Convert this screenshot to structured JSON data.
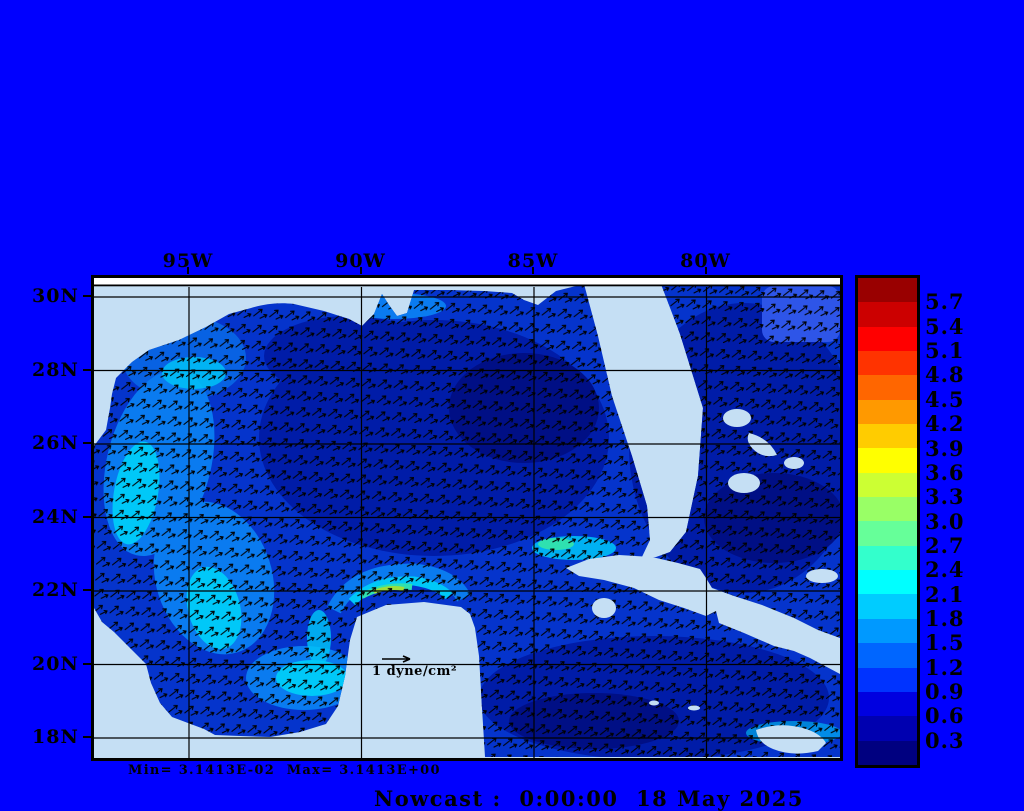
{
  "colors": {
    "background": "#0000FF",
    "land": "#C5DFF4",
    "water": "#0534CC",
    "frame": "#000000",
    "text": "#000000"
  },
  "axes": {
    "lon_ticks": [
      "95W",
      "90W",
      "85W",
      "80W"
    ],
    "lat_ticks": [
      "30N",
      "28N",
      "26N",
      "24N",
      "22N",
      "20N",
      "18N"
    ]
  },
  "colorbar": {
    "tick_labels": [
      "5.7",
      "5.4",
      "5.1",
      "4.8",
      "4.5",
      "4.2",
      "3.9",
      "3.6",
      "3.3",
      "3.0",
      "2.7",
      "2.4",
      "2.1",
      "1.8",
      "1.5",
      "1.2",
      "0.9",
      "0.6",
      "0.3"
    ],
    "segment_colors_top_to_bottom": [
      "#990000",
      "#CC0000",
      "#FF0000",
      "#FF3300",
      "#FF6600",
      "#FF9900",
      "#FFCC00",
      "#FFFF00",
      "#CCFF33",
      "#99FF66",
      "#66FF99",
      "#33FFCC",
      "#00FFFF",
      "#00CCFF",
      "#0099FF",
      "#0066FF",
      "#0033FF",
      "#0000E0",
      "#0000B0",
      "#000080"
    ]
  },
  "annotations": {
    "min_max": "Min= 3.1413E-02  Max= 3.1413E+00",
    "reference_vector_label": "1 dyne/cm²"
  },
  "footer": {
    "text": "Nowcast :  0:00:00  18 May 2025"
  },
  "chart_data": {
    "type": "vector_field_map",
    "region_ticks": {
      "x": [
        "95W",
        "90W",
        "85W",
        "80W"
      ],
      "y": [
        "30N",
        "28N",
        "26N",
        "24N",
        "22N",
        "20N",
        "18N"
      ]
    },
    "colorbar_levels": [
      0.3,
      0.6,
      0.9,
      1.2,
      1.5,
      1.8,
      2.1,
      2.4,
      2.7,
      3.0,
      3.3,
      3.6,
      3.9,
      4.2,
      4.5,
      4.8,
      5.1,
      5.4,
      5.7
    ],
    "colorbar_colors_low_to_high": [
      "#000080",
      "#0000B0",
      "#0000E0",
      "#0033FF",
      "#0066FF",
      "#0099FF",
      "#00CCFF",
      "#00FFFF",
      "#33FFCC",
      "#66FF99",
      "#99FF66",
      "#CCFF33",
      "#FFFF00",
      "#FFCC00",
      "#FF9900",
      "#FF6600",
      "#FF3300",
      "#FF0000",
      "#CC0000",
      "#990000"
    ],
    "min_label": "Min= 3.1413E-02",
    "max_label": "Max= 3.1413E+00",
    "reference_vector": "1 dyne/cm²",
    "timestamp_label": "Nowcast :  0:00:00  18 May 2025"
  }
}
